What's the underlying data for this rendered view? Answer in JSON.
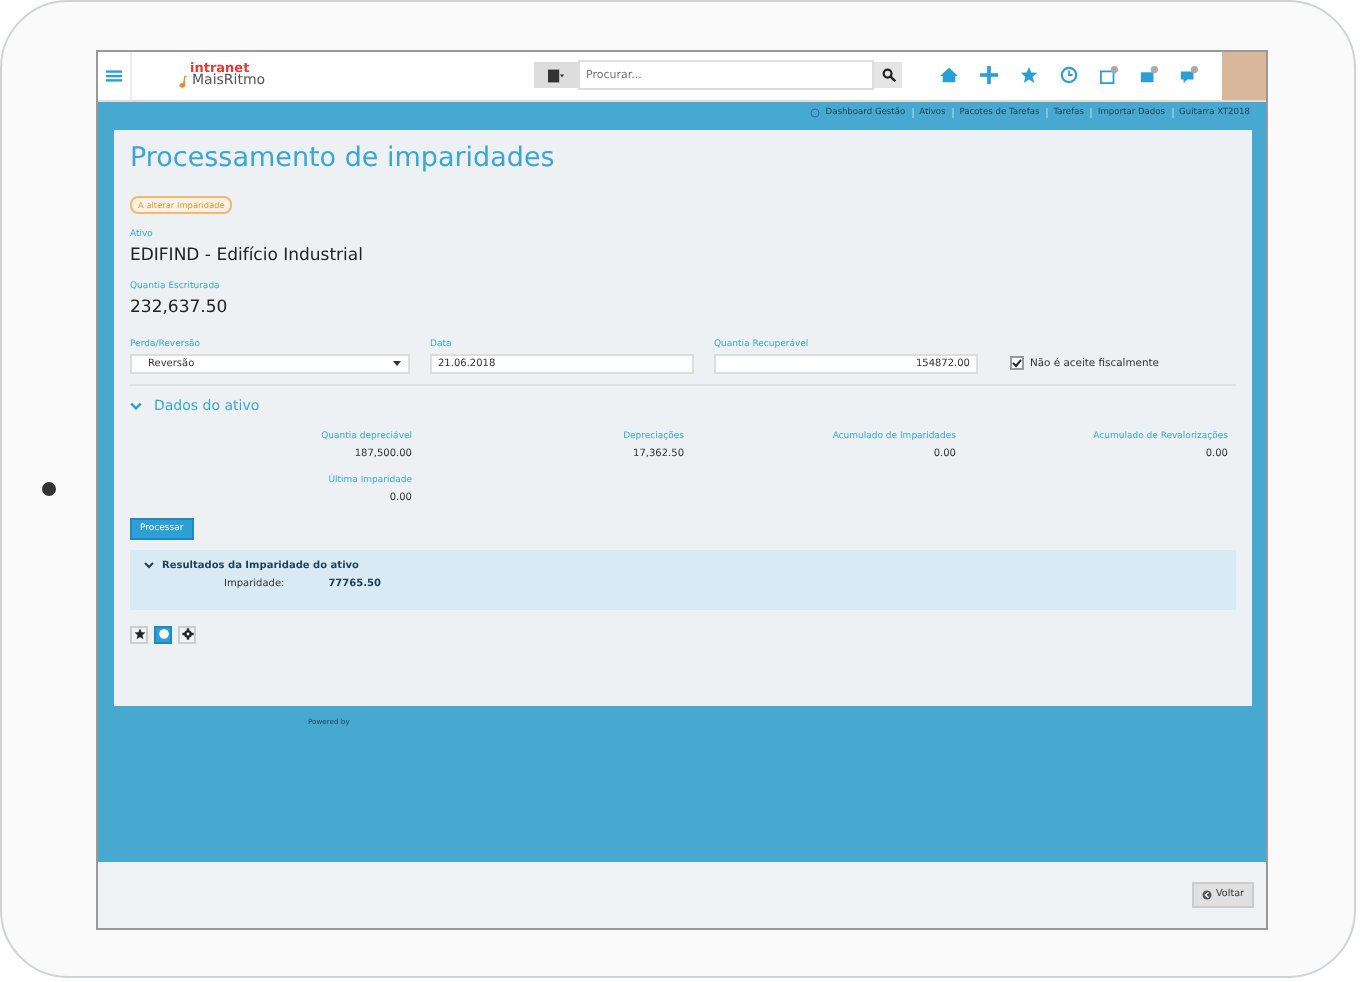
{
  "topbar": {
    "logo_top": "intranet",
    "logo_bottom": "MaisRitmo",
    "search": {
      "placeholder": "Procurar..."
    }
  },
  "nav_links": [
    "Dashboard Gestão",
    "Ativos",
    "Pacotes de Tarefas",
    "Tarefas",
    "Importar Dados",
    "Guitarra XT2018"
  ],
  "page": {
    "title": "Processamento de imparidades",
    "status_badge": "A alterar Imparidade",
    "asset": {
      "label": "Ativo",
      "value": "EDIFIND - Edifício Industrial"
    },
    "book_value": {
      "label": "Quantia Escriturada",
      "value": "232,637.50"
    },
    "fields": [
      {
        "kind": "select",
        "label": "Perda/Reversão",
        "value": "Reversão"
      },
      {
        "kind": "text",
        "label": "Data",
        "value": "21.06.2018"
      },
      {
        "kind": "number",
        "label": "Quantia Recuperável",
        "value": "154872.00"
      }
    ],
    "fiscal_checkbox": {
      "label": "Não é aceite fiscalmente",
      "checked": true
    },
    "section": {
      "title": "Dados do ativo",
      "expanded": true,
      "stats": [
        {
          "label": "Quantia depreciável",
          "value": "187,500.00"
        },
        {
          "label": "Depreciações",
          "value": "17,362.50"
        },
        {
          "label": "Acumulado de Imparidades",
          "value": "0.00"
        },
        {
          "label": "Acumulado de Revalorizações",
          "value": "0.00"
        },
        {
          "label": "Última Imparidade",
          "value": "0.00"
        }
      ]
    },
    "process_button": "Processar",
    "results": {
      "title": "Resultados da Imparidade do ativo",
      "expanded": true,
      "label": "Imparidade:",
      "value": "77765.50"
    },
    "tools": [
      {
        "kind": "star",
        "selected": false
      },
      {
        "kind": "toggle",
        "selected": true
      },
      {
        "kind": "gear",
        "selected": false
      }
    ]
  },
  "footer": {
    "powered_by": "Powered by",
    "back_button": "Voltar"
  }
}
